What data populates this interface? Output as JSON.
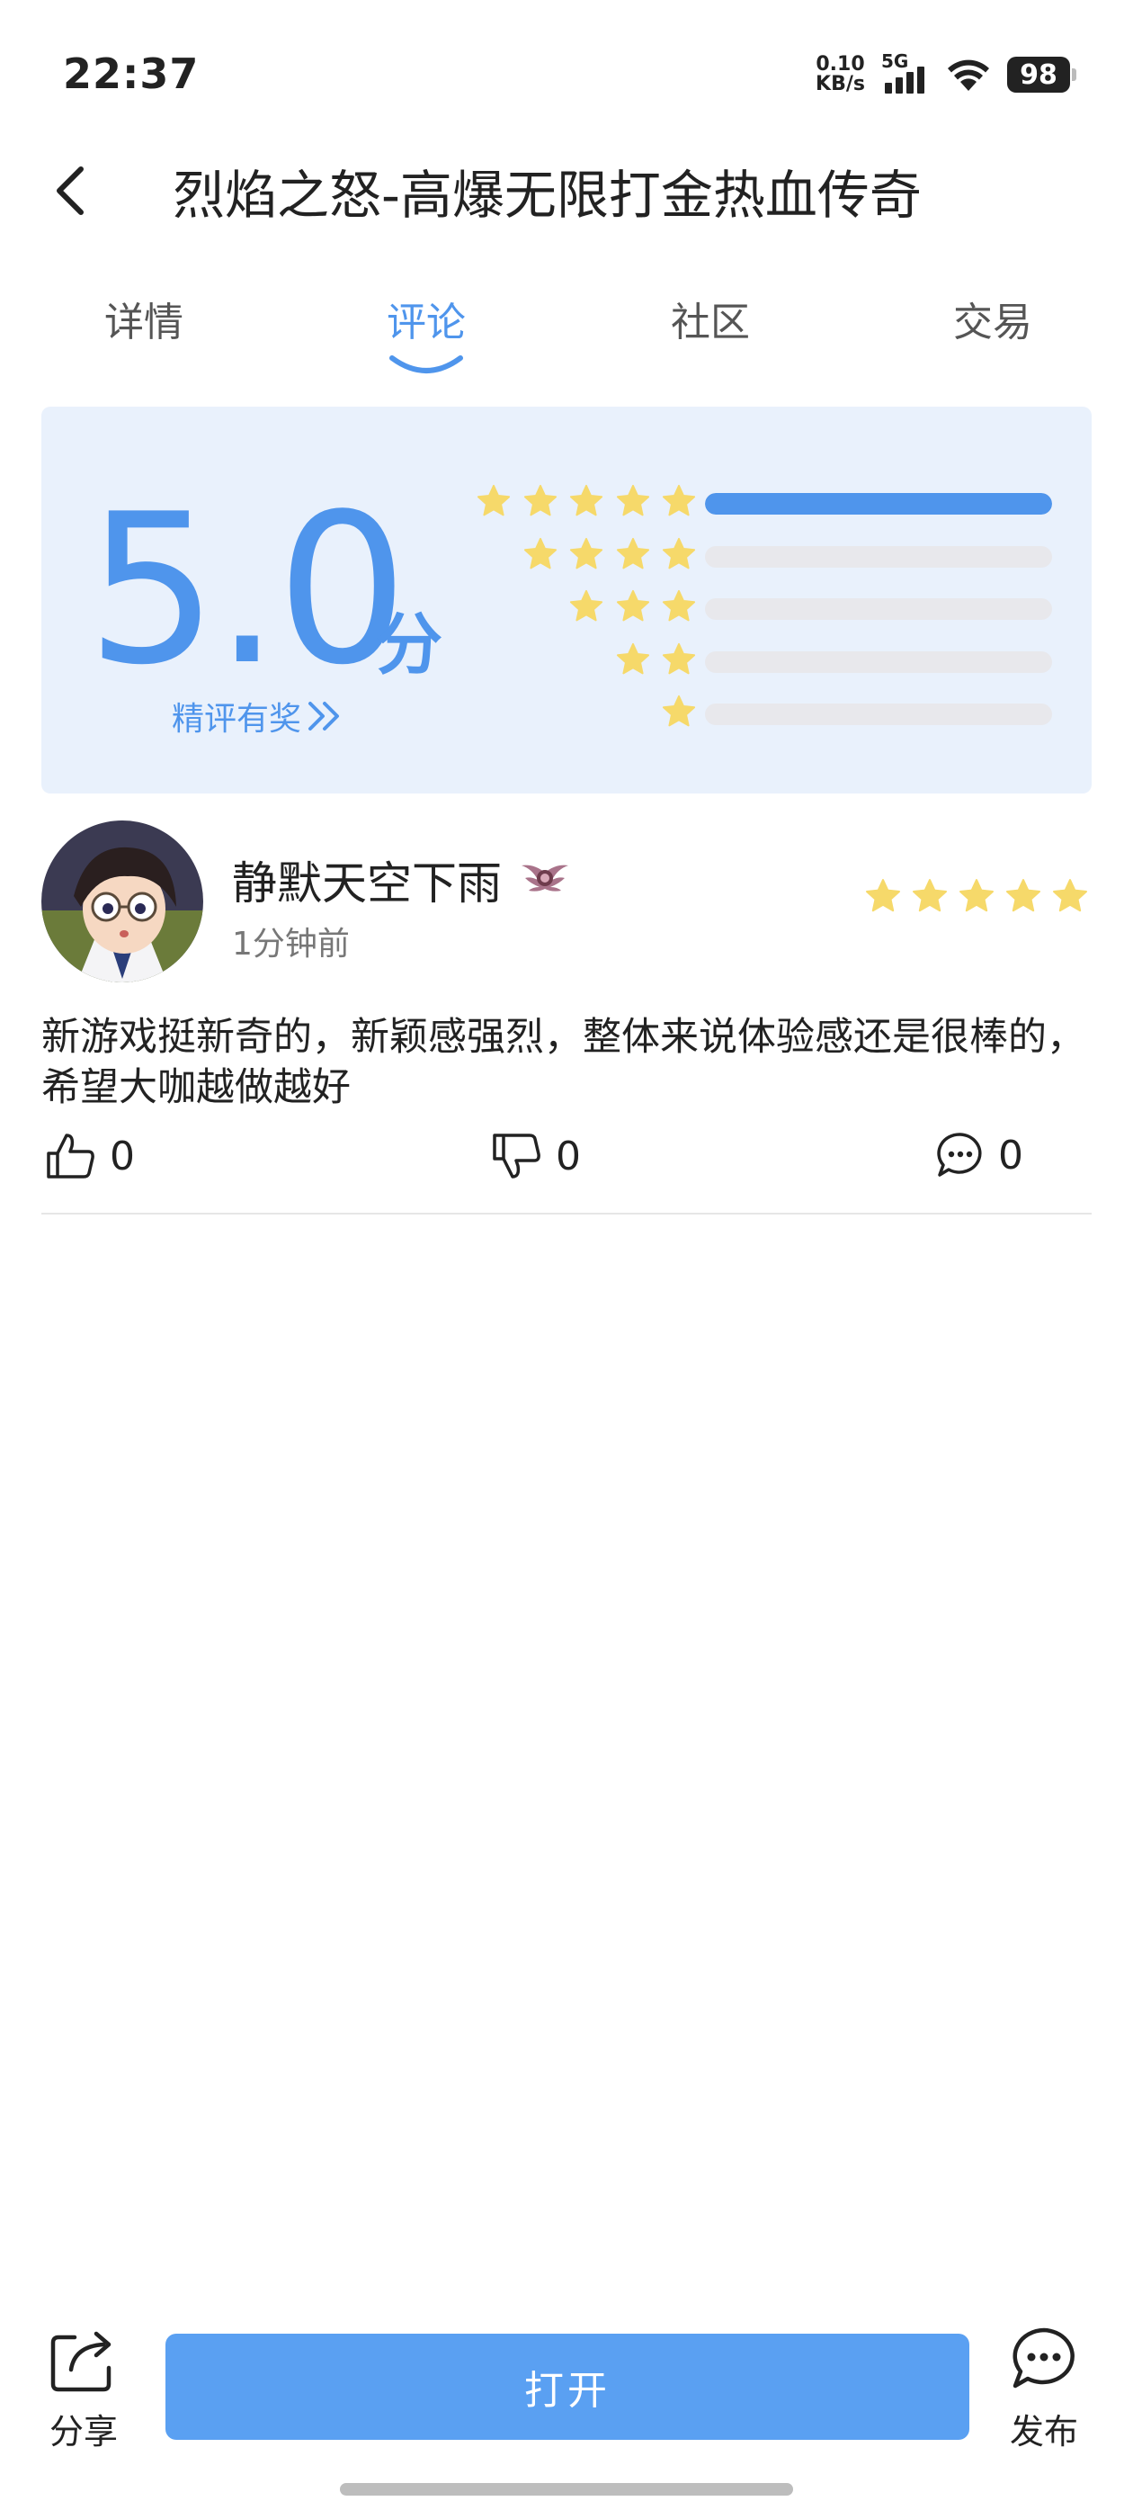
{
  "status_bar": {
    "time": "22:37",
    "net_speed_value": "0.10",
    "net_speed_unit": "KB/s",
    "network_type": "5G",
    "battery": "98"
  },
  "header": {
    "title": "烈焰之怒-高爆无限打金热血传奇"
  },
  "tabs": [
    {
      "label": "详情",
      "active": false
    },
    {
      "label": "评论",
      "active": true
    },
    {
      "label": "社区",
      "active": false
    },
    {
      "label": "交易",
      "active": false
    }
  ],
  "rating": {
    "score": "5.0",
    "unit": "分",
    "reward_link": "精评有奖",
    "distribution": [
      {
        "stars": 5,
        "fraction": 1.0
      },
      {
        "stars": 4,
        "fraction": 0.0
      },
      {
        "stars": 3,
        "fraction": 0.0
      },
      {
        "stars": 2,
        "fraction": 0.0
      },
      {
        "stars": 1,
        "fraction": 0.0
      }
    ]
  },
  "review": {
    "user_name": "静默天空下雨",
    "time": "1分钟前",
    "stars": 5,
    "text": "新游戏挺新奇的，新颖感强烈，整体来说体验感还是很棒的，希望大咖越做越好",
    "likes": "0",
    "dislikes": "0",
    "comments": "0"
  },
  "bottom_bar": {
    "share_label": "分享",
    "open_label": "打开",
    "publish_label": "发布"
  },
  "colors": {
    "accent": "#4f95ec",
    "star": "#f6d96a",
    "card_bg": "#e9f1fc"
  }
}
